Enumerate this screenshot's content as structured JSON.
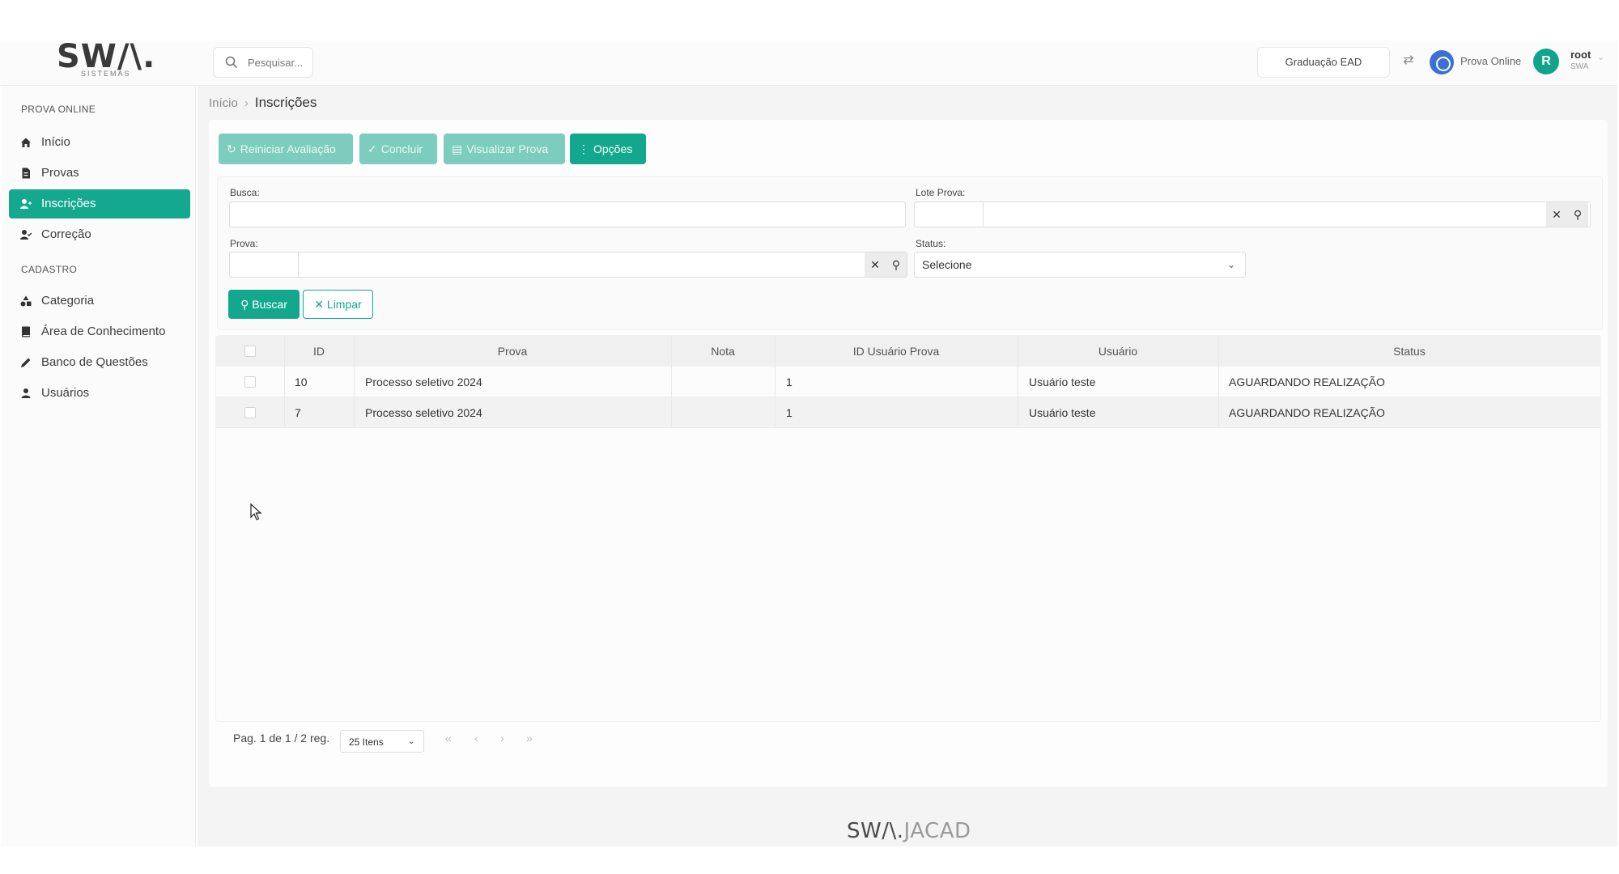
{
  "brand": {
    "logo": "SW/\\.",
    "logo_sub": "SISTEMAS"
  },
  "header": {
    "search_placeholder": "Pesquisar...",
    "institution": "Graduação EAD",
    "module": "Prova Online",
    "avatar_letter": "R",
    "user_name": "root",
    "user_org": "SWA"
  },
  "sidebar": {
    "section1": "PROVA ONLINE",
    "section2": "CADASTRO",
    "items": [
      {
        "label": "Início",
        "icon": "home-icon"
      },
      {
        "label": "Provas",
        "icon": "file-icon"
      },
      {
        "label": "Inscrições",
        "icon": "user-plus-icon"
      },
      {
        "label": "Correção",
        "icon": "user-check-icon"
      },
      {
        "label": "Categoria",
        "icon": "shapes-icon"
      },
      {
        "label": "Área de Conhecimento",
        "icon": "book-icon"
      },
      {
        "label": "Banco de Questões",
        "icon": "pencil-icon"
      },
      {
        "label": "Usuários",
        "icon": "user-icon"
      }
    ]
  },
  "breadcrumb": {
    "home": "Início",
    "current": "Inscrições"
  },
  "toolbar": {
    "reset": "Reiniciar Avaliação",
    "conclude": "Concluir",
    "view": "Visualizar Prova",
    "options": "Opções"
  },
  "filters": {
    "busca_label": "Busca:",
    "lote_label": "Lote Prova:",
    "prova_label": "Prova:",
    "status_label": "Status:",
    "status_value": "Selecione",
    "search_btn": "Buscar",
    "clear_btn": "Limpar"
  },
  "table": {
    "headers": [
      "ID",
      "Prova",
      "Nota",
      "ID Usuário Prova",
      "Usuário",
      "Status"
    ],
    "rows": [
      {
        "id": "10",
        "prova": "Processo seletivo 2024",
        "nota": "",
        "id_usuario_prova": "1",
        "usuario": "Usuário teste",
        "status": "AGUARDANDO REALIZAÇÃO"
      },
      {
        "id": "7",
        "prova": "Processo seletivo 2024",
        "nota": "",
        "id_usuario_prova": "1",
        "usuario": "Usuário teste",
        "status": "AGUARDANDO REALIZAÇÃO"
      }
    ]
  },
  "pagination": {
    "summary": "Pag. 1 de 1 / 2 reg.",
    "page_size": "25 Itens",
    "first": "«",
    "prev": "‹",
    "next": "›",
    "last": "»"
  },
  "footer": {
    "brand": "SW/\\.",
    "product": "JACAD"
  },
  "colors": {
    "accent": "#13a88d",
    "accent_light": "#7ccdbd",
    "avatar": "#12a48a",
    "module_icon": "#3d6fd6"
  }
}
